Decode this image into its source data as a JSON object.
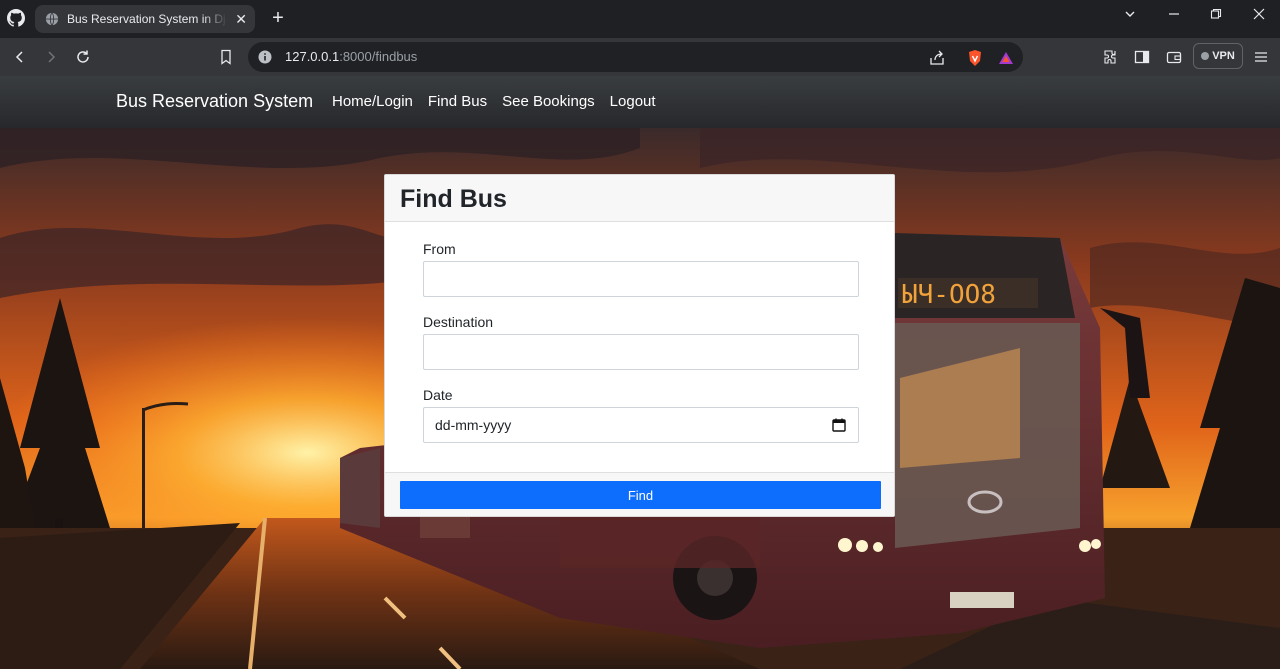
{
  "browser": {
    "tab_title": "Bus Reservation System in Django",
    "tab_close": "✕",
    "new_tab": "+",
    "url_host": "127.0.0.1",
    "url_path": ":8000/findbus",
    "vpn_label": "VPN"
  },
  "navbar": {
    "brand": "Bus Reservation System",
    "links": [
      "Home/Login",
      "Find Bus",
      "See Bookings",
      "Logout"
    ]
  },
  "form": {
    "title": "Find Bus",
    "from_label": "From",
    "from_value": "",
    "destination_label": "Destination",
    "destination_value": "",
    "date_label": "Date",
    "date_placeholder": "dd-mm-yyyy",
    "submit_label": "Find"
  },
  "colors": {
    "primary": "#0d6efd",
    "navbar": "#2f3235",
    "chrome_dark": "#1f2023",
    "chrome_toolbar": "#35363a"
  }
}
